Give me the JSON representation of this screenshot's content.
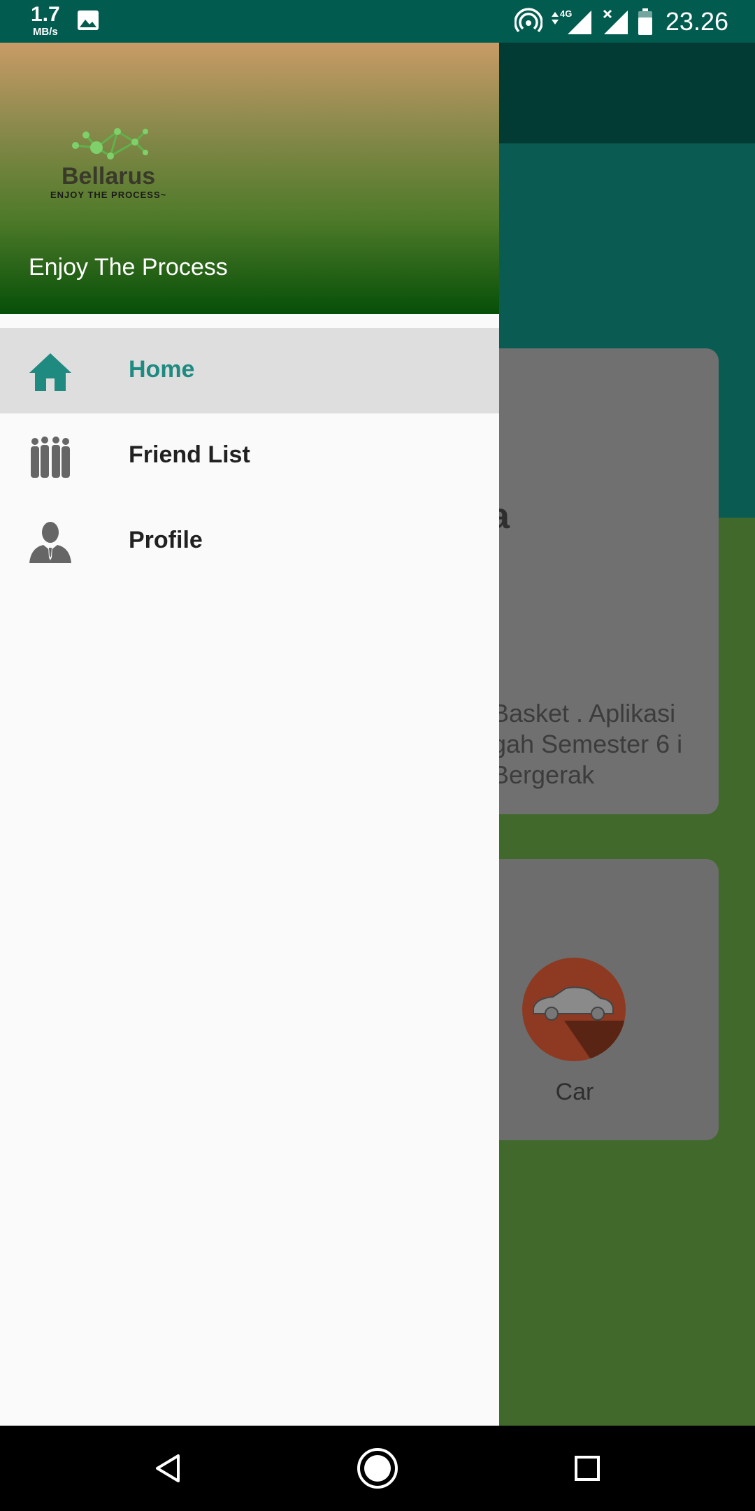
{
  "status_bar": {
    "speed_value": "1.7",
    "speed_unit": "MB/s",
    "network": "4G",
    "time": "23.26",
    "icons": [
      "gallery-icon",
      "hotspot-icon",
      "signal-icon",
      "signal-x-icon",
      "battery-icon"
    ]
  },
  "drawer": {
    "header_logo_name": "Bellarus",
    "header_logo_tagline": "ENJOY THE PROCESS~",
    "header_title": "Enjoy The Process",
    "menu": [
      {
        "label": "Home",
        "icon": "home-icon",
        "selected": true
      },
      {
        "label": "Friend List",
        "icon": "group-icon",
        "selected": false
      },
      {
        "label": "Profile",
        "icon": "person-icon",
        "selected": false
      }
    ]
  },
  "background": {
    "card1_fragment": "a",
    "card1_text": "Basket . Aplikasi gah Semester 6 i Bergerak",
    "card2_label": "Car"
  },
  "colors": {
    "status_bar": "#015b4f",
    "accent": "#1e8a80",
    "selected_bg": "#dedede",
    "drawer_bg": "#fafafa"
  },
  "nav_bar": {
    "buttons": [
      "back-icon",
      "home-button-icon",
      "recents-icon"
    ]
  }
}
